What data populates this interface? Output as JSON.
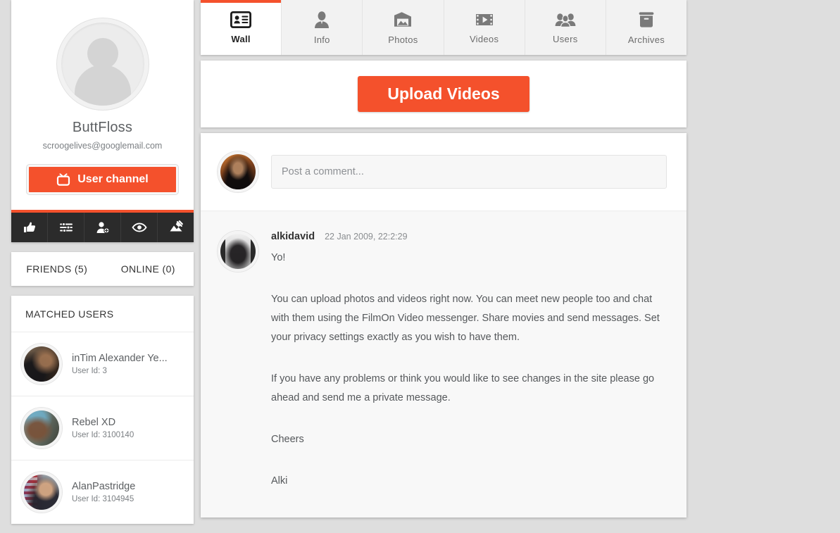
{
  "theme": {
    "accent": "#f4512c",
    "page_bg": "#dedede",
    "dark_bar": "#2b2b2b"
  },
  "profile": {
    "username": "ButtFloss",
    "email": "scroogelives@googlemail.com",
    "channel_button": "User channel",
    "avatar_alt": "default-user-avatar",
    "action_icons": [
      {
        "name": "thumbs-up-icon"
      },
      {
        "name": "settings-sliders-icon"
      },
      {
        "name": "add-user-icon"
      },
      {
        "name": "eye-icon"
      },
      {
        "name": "photo-edit-icon"
      }
    ]
  },
  "friends_bar": {
    "friends_label": "FRIENDS (5)",
    "online_label": "ONLINE (0)"
  },
  "matched_users": {
    "title": "MATCHED USERS",
    "id_prefix": "User Id: ",
    "items": [
      {
        "name": "inTim Alexander Ye...",
        "id_label": "User Id: 3"
      },
      {
        "name": "Rebel XD",
        "id_label": "User Id: 3100140"
      },
      {
        "name": "AlanPastridge",
        "id_label": "User Id: 3104945"
      }
    ]
  },
  "tabs": [
    {
      "label": "Wall",
      "icon": "id-card-icon",
      "active": true
    },
    {
      "label": "Info",
      "icon": "person-icon",
      "active": false
    },
    {
      "label": "Photos",
      "icon": "photo-icon",
      "active": false
    },
    {
      "label": "Videos",
      "icon": "film-play-icon",
      "active": false
    },
    {
      "label": "Users",
      "icon": "users-icon",
      "active": false
    },
    {
      "label": "Archives",
      "icon": "archive-box-icon",
      "active": false
    }
  ],
  "upload": {
    "button_label": "Upload Videos"
  },
  "comment_box": {
    "placeholder": "Post a comment...",
    "value": ""
  },
  "post": {
    "author": "alkidavid",
    "timestamp": "22 Jan 2009, 22:2:29",
    "paragraphs": [
      "Yo!",
      "You can upload photos and videos right now. You can meet new people too and chat with them using the FilmOn Video messenger. Share movies and send messages. Set your privacy settings exactly as you wish to have them.",
      "If you have any problems or think you would like to see changes in the site please go ahead and send me a private message.",
      "Cheers",
      "Alki"
    ]
  }
}
